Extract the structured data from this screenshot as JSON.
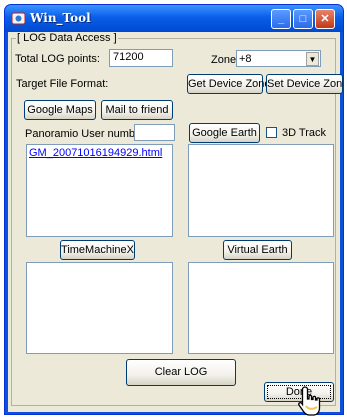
{
  "window": {
    "title": "Win_Tool"
  },
  "group": {
    "label": "[ LOG Data Access ]"
  },
  "total_log": {
    "label": "Total LOG points:",
    "value": "71200"
  },
  "zone": {
    "label": "Zone:",
    "value": "+8"
  },
  "target_format": {
    "label": "Target File Format:"
  },
  "buttons": {
    "get_zone": "Get Device Zone",
    "set_zone": "Set Device Zone",
    "google_maps": "Google Maps",
    "mail_friend": "Mail to friend",
    "google_earth": "Google Earth",
    "time_machine": "TimeMachineX",
    "virtual_earth": "Virtual Earth",
    "clear_log": "Clear LOG",
    "done": "Done"
  },
  "panoramio": {
    "label": "Panoramio User number",
    "value": ""
  },
  "track_3d": {
    "label": "3D Track",
    "checked": false
  },
  "list_google_maps": {
    "items": [
      "GM_20071016194929.html"
    ]
  }
}
